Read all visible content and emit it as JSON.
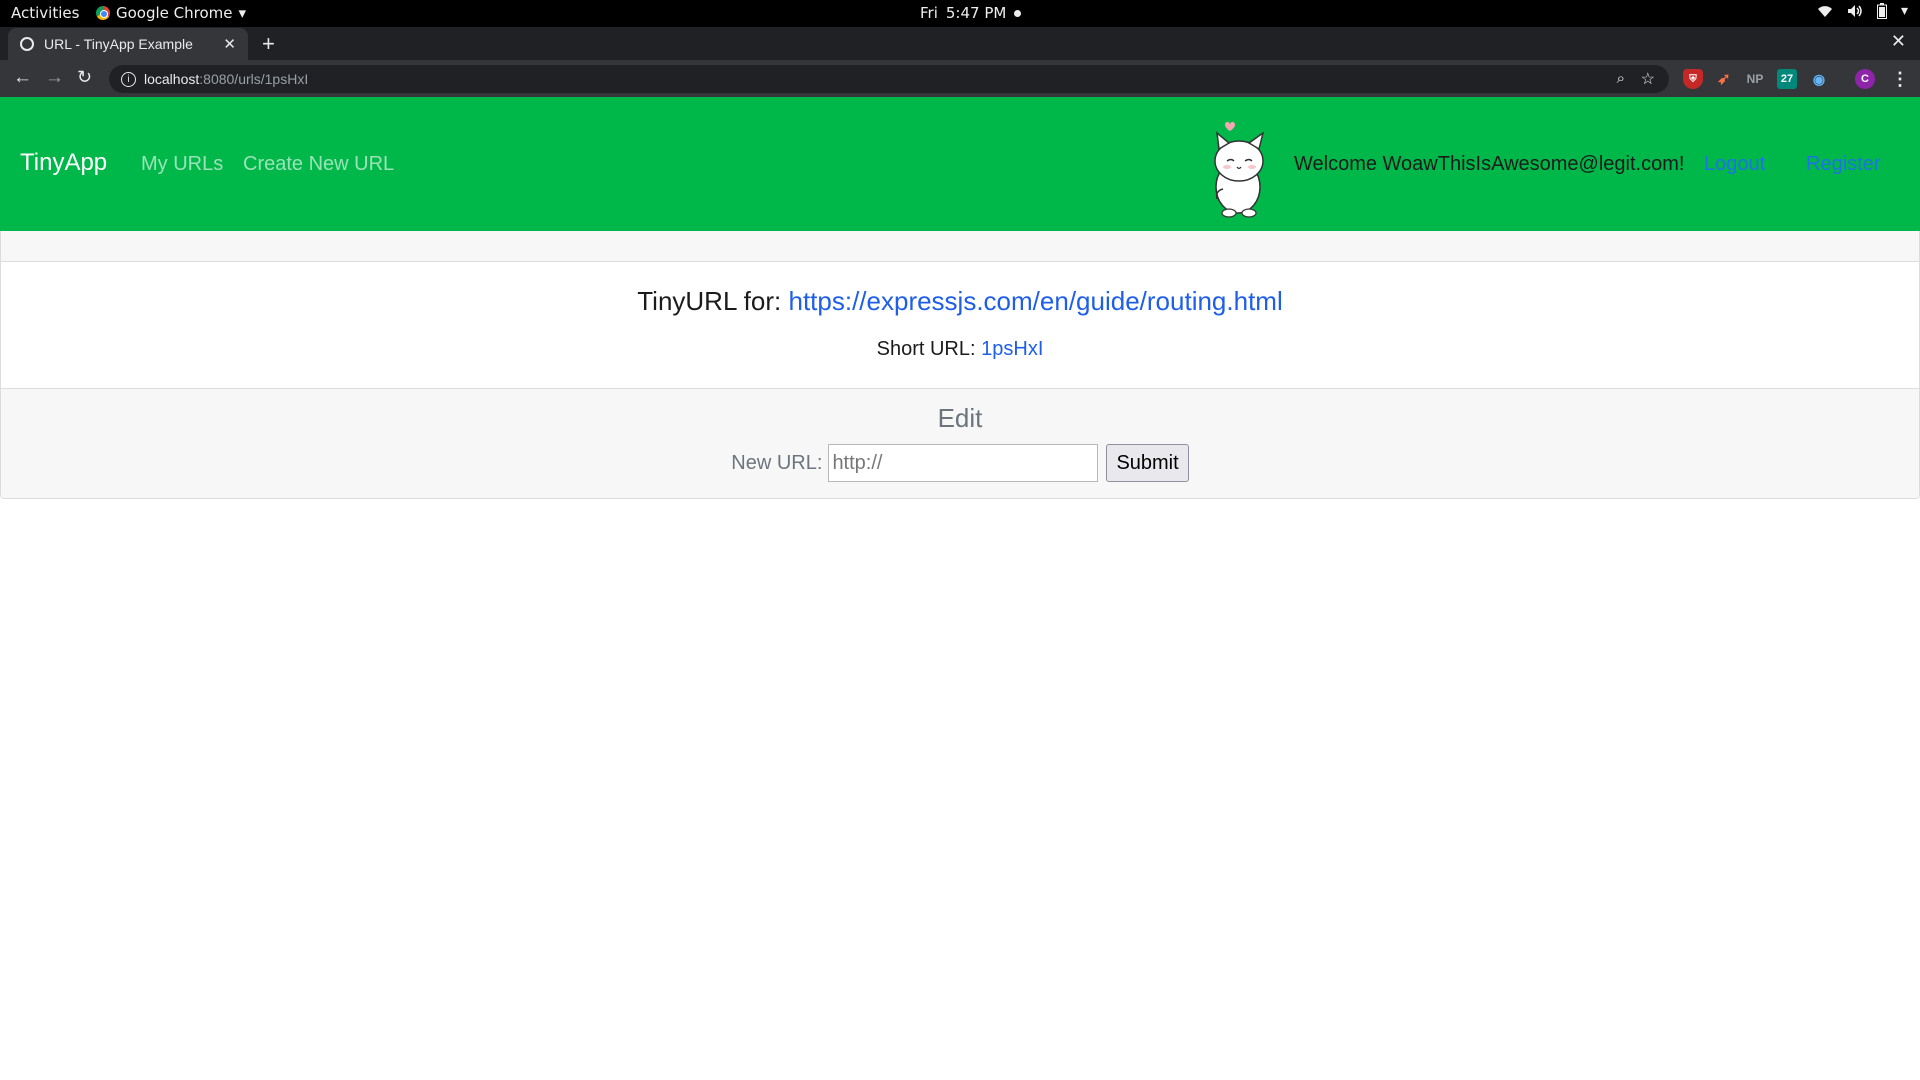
{
  "os_bar": {
    "activities": "Activities",
    "app_name": "Google Chrome",
    "day": "Fri",
    "time": "5:47 PM"
  },
  "browser": {
    "tab_title": "URL - TinyApp Example",
    "url_host": "localhost",
    "url_path": ":8080/urls/1psHxI",
    "extensions": [
      "ublock-shield-icon",
      "fox-icon",
      "NP",
      "27",
      "palette-icon"
    ],
    "profile_initial": "C"
  },
  "navbar": {
    "brand": "TinyApp",
    "links": [
      "My URLs",
      "Create New URL"
    ],
    "welcome": "Welcome WoawThisIsAwesome@legit.com!",
    "logout": "Logout",
    "register": "Register",
    "bg_color": "#00b84a"
  },
  "card": {
    "title_prefix": "TinyURL for:",
    "long_url": "https://expressjs.com/en/guide/routing.html",
    "short_label": "Short URL:",
    "short_id": "1psHxI"
  },
  "edit": {
    "heading": "Edit",
    "label": "New URL:",
    "placeholder": "http://",
    "submit": "Submit"
  }
}
